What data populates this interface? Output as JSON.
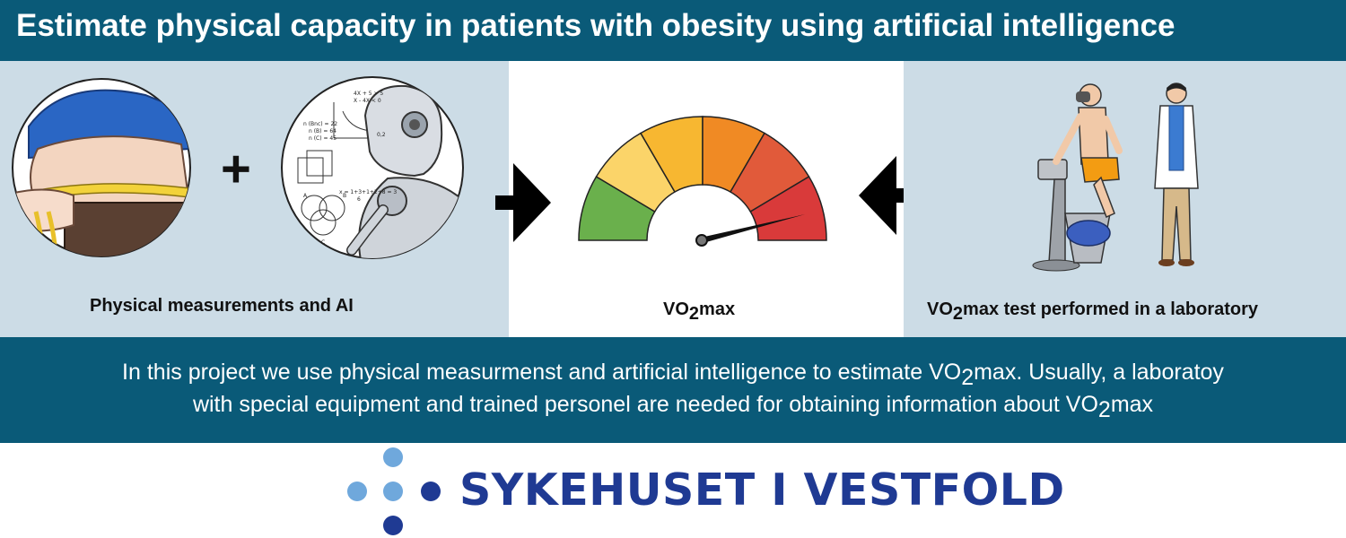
{
  "header": {
    "title": "Estimate physical capacity in patients with obesity using artificial intelligence"
  },
  "panels": {
    "left": {
      "caption": "Physical measurements and AI",
      "plus_symbol": "+"
    },
    "middle": {
      "caption_base": "VO",
      "caption_sub": "2",
      "caption_rest": "max"
    },
    "right": {
      "caption_base": "VO",
      "caption_sub": "2",
      "caption_rest": "max test performed in a laboratory"
    }
  },
  "ai_formulas": {
    "top1": "4X + 5 > 5",
    "top2": "X - 4X < 0",
    "graph_label": "0,2",
    "n_bnc": "n (Bnc) = 22",
    "n_b": "n (B) = 64",
    "n_c": "n (C) = 45",
    "mean": "x = 1+3+1+2+8 = 3",
    "mean_den": "6",
    "venn_a": "A",
    "venn_b": "B",
    "venn_c": "C"
  },
  "footer": {
    "line1_a": "In this project we use physical measurmenst and artificial intelligence to estimate VO",
    "line1_sub": "2",
    "line1_b": "max. Usually, a laboratoy",
    "line2_a": "with special equipment and trained personel are needed for obtaining information about VO",
    "line2_sub": "2",
    "line2_b": "max"
  },
  "logo": {
    "text": "SYKEHUSET I VESTFOLD"
  },
  "colors": {
    "banner": "#0a5a78",
    "panel_bg": "#ccdce6",
    "logo_blue_dark": "#1f3a93",
    "logo_blue_light": "#6fa8dc",
    "gauge_green": "#6ab04c",
    "gauge_light_yellow": "#fbd469",
    "gauge_yellow": "#f7b731",
    "gauge_orange": "#f08a24",
    "gauge_red_orange": "#e15a3a",
    "gauge_red": "#d93a3a"
  }
}
